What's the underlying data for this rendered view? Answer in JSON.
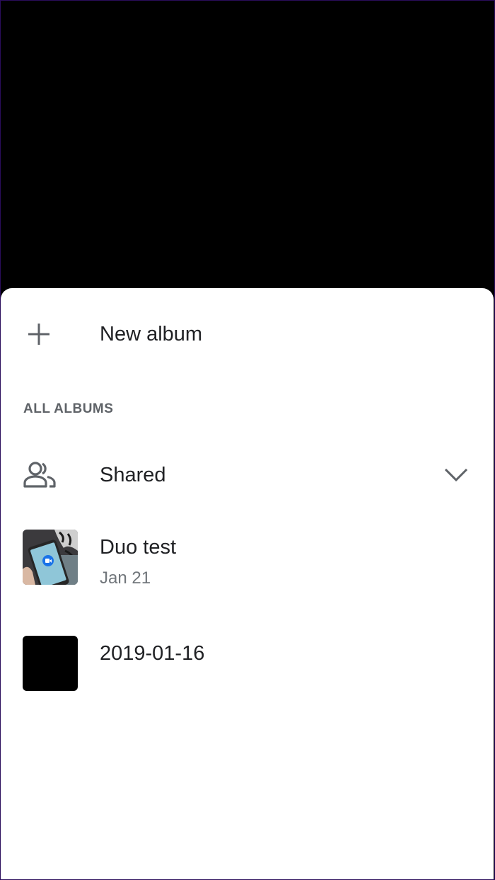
{
  "new_album": {
    "icon": "plus-icon",
    "label": "New album"
  },
  "section": {
    "title": "ALL ALBUMS"
  },
  "shared": {
    "icon": "people-icon",
    "label": "Shared",
    "expand_icon": "chevron-down-icon"
  },
  "albums": [
    {
      "title": "Duo test",
      "subtitle": "Jan 21",
      "thumbnail": "phone-photo"
    },
    {
      "title": "2019-01-16",
      "subtitle": "",
      "thumbnail": "black"
    }
  ],
  "colors": {
    "text_primary": "#202124",
    "text_secondary": "#70757a",
    "icon": "#5f6368",
    "sheet_bg": "#ffffff",
    "backdrop": "#000000"
  }
}
